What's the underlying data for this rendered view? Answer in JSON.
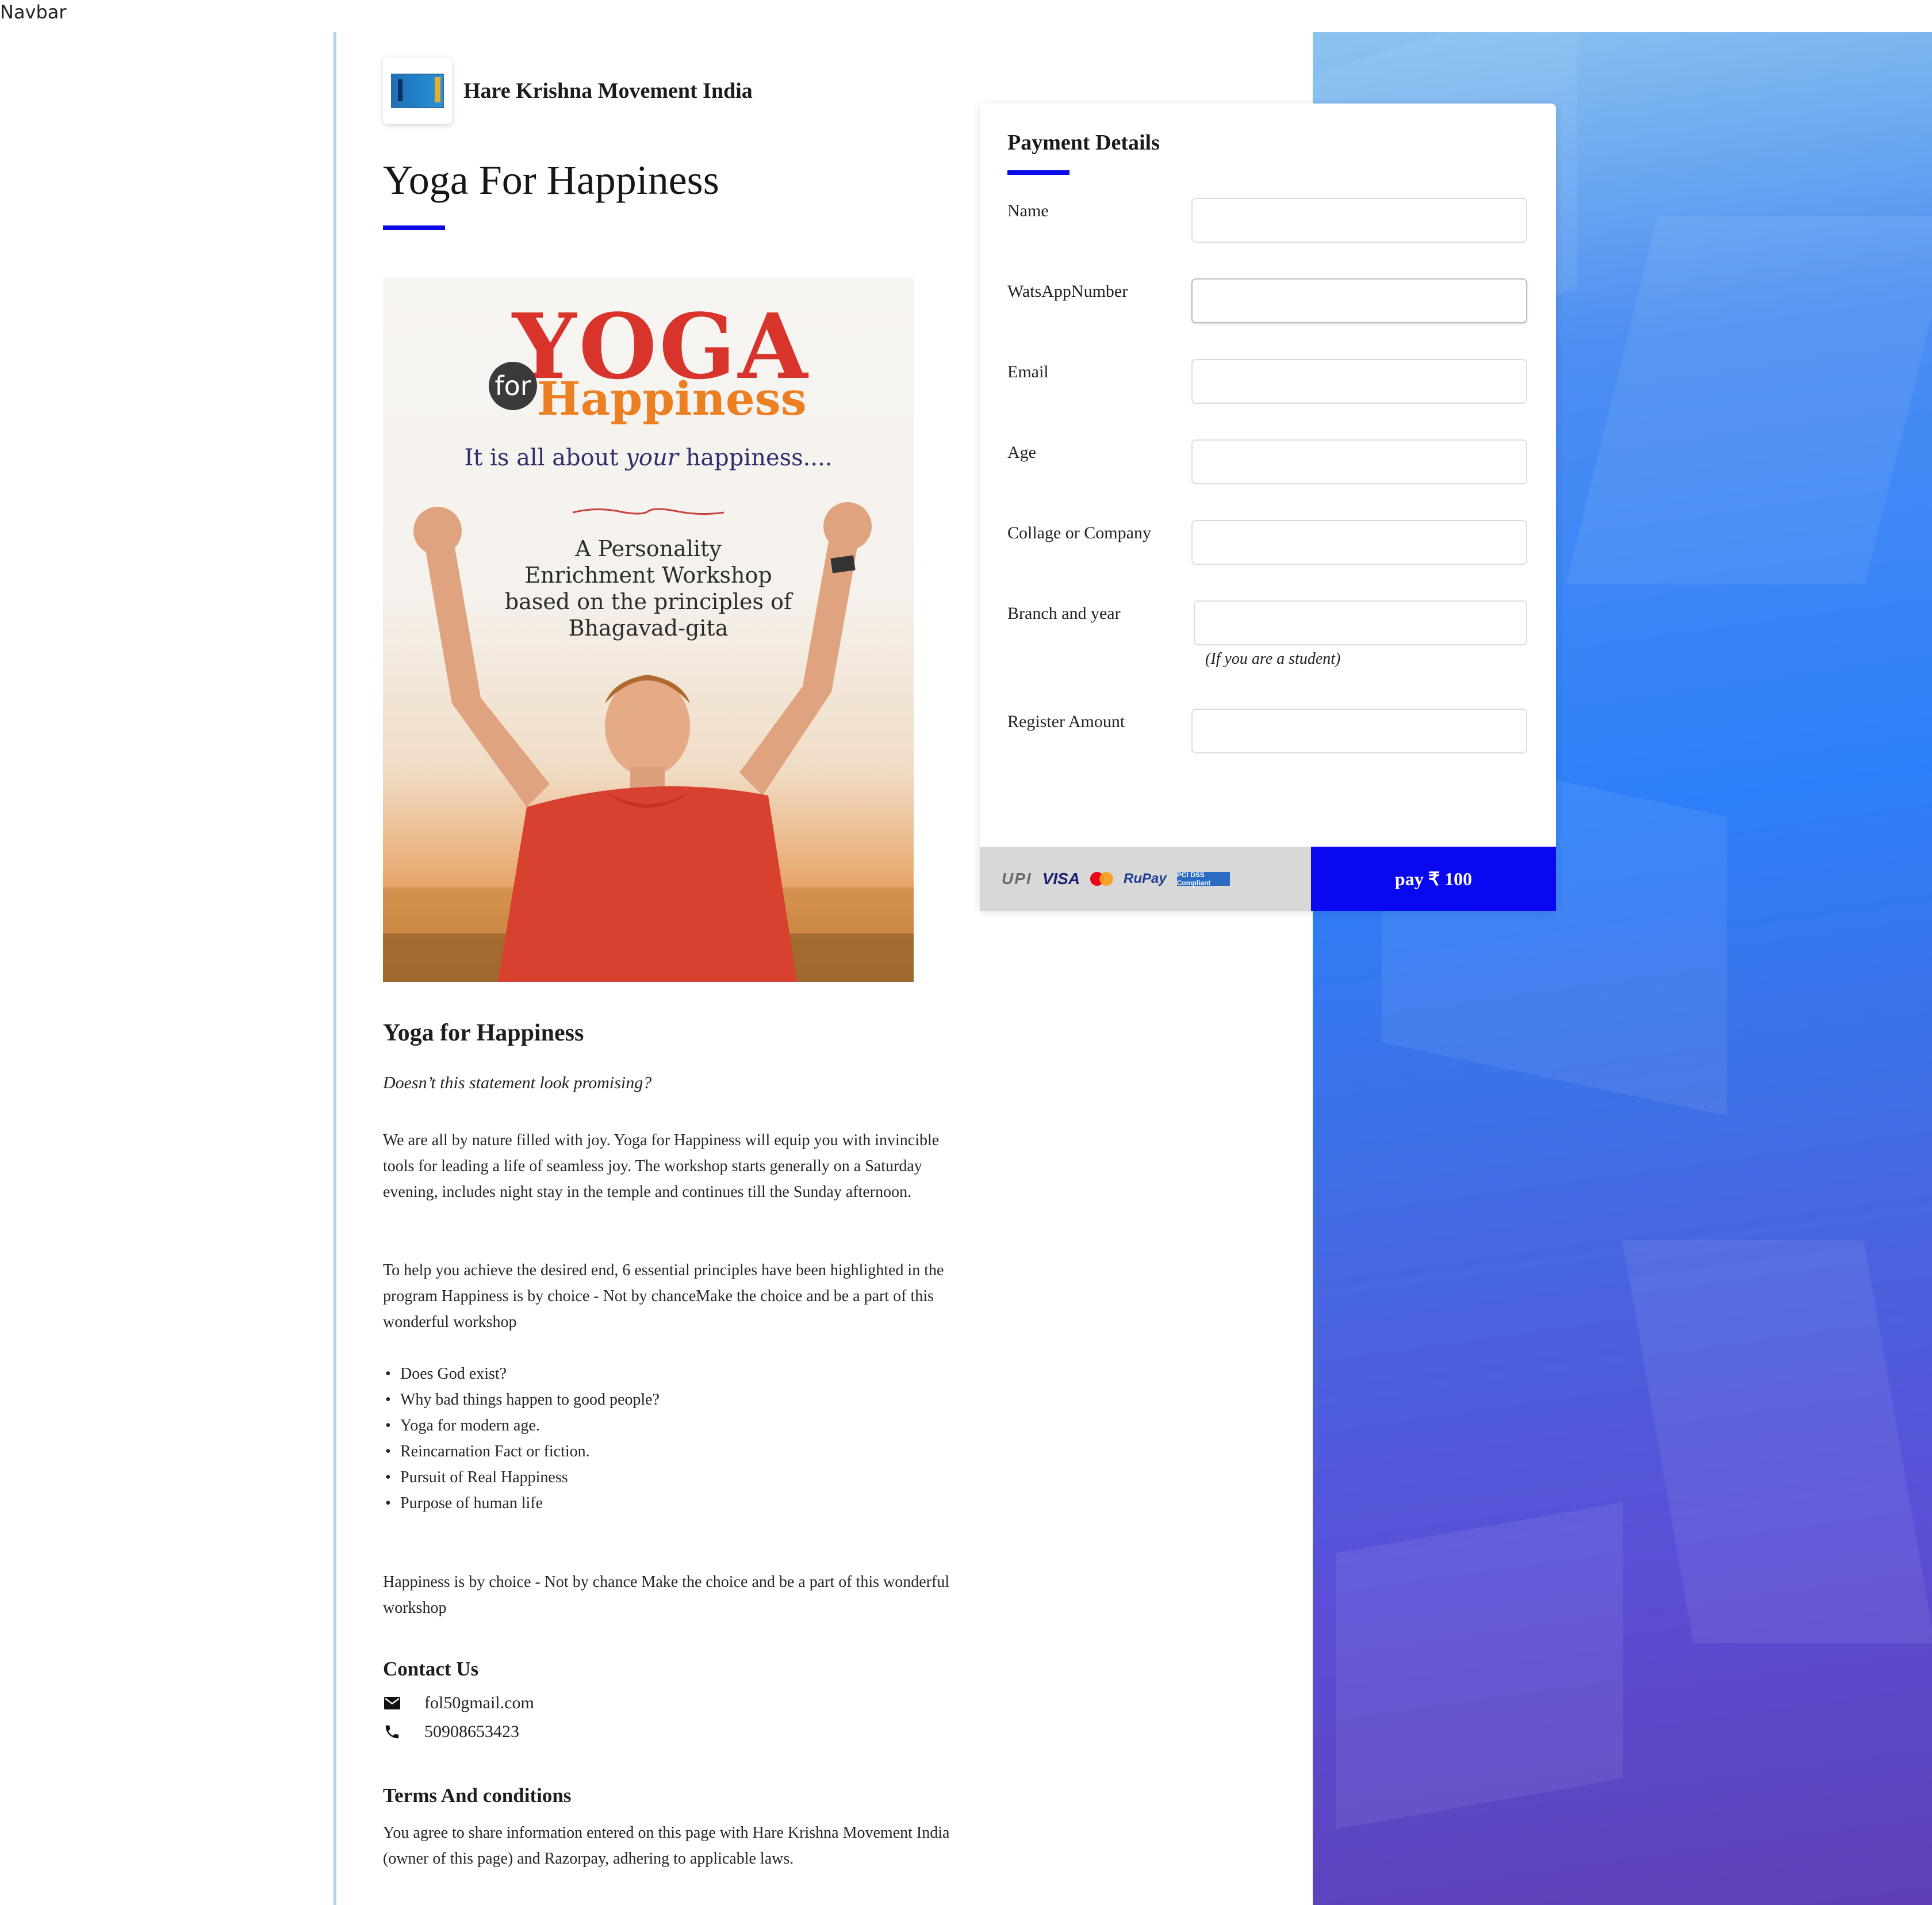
{
  "navbar": {
    "label": "Navbar"
  },
  "brand": {
    "name": "Hare Krishna Movement India",
    "logo_icon": "organization-logo-icon"
  },
  "page": {
    "title": "Yoga For Happiness"
  },
  "poster": {
    "headline_word": "YOGA",
    "for_word": "for",
    "happiness_word": "Happiness",
    "tagline_prefix": "It is all about ",
    "tagline_em": "your",
    "tagline_suffix": " happiness....",
    "subtitle_lines": [
      "A Personality",
      "Enrichment Workshop",
      "based on the principles of",
      "Bhagavad-gita"
    ]
  },
  "description": {
    "heading": "Yoga for Happiness",
    "tagline": "Doesn’t this statement look promising?",
    "paragraph_1": "We are all by nature filled with joy. Yoga for Happiness will equip you with invincible tools for leading a life of seamless joy. The workshop starts generally on a Saturday evening, includes night stay in the temple and continues till the Sunday afternoon.",
    "paragraph_2": "To help you achieve the desired end, 6 essential principles have been highlighted in the program Happiness is by choice - Not by chanceMake the choice and be a part of this wonderful workshop",
    "bullets": [
      "Does God exist?",
      "Why bad things happen to good people?",
      "Yoga for modern age.",
      "Reincarnation Fact or fiction.",
      "Pursuit of Real Happiness",
      "Purpose of human life"
    ],
    "paragraph_3": "Happiness is by choice - Not by chance Make the choice and be a part of this wonderful workshop"
  },
  "contact": {
    "heading": "Contact Us",
    "email": "fol50gmail.com",
    "phone": "50908653423",
    "email_icon": "mail-icon",
    "phone_icon": "phone-icon"
  },
  "terms": {
    "heading": "Terms And conditions",
    "text": "You agree to share information entered on this page with Hare Krishna Movement India (owner of this page) and Razorpay, adhering to applicable laws."
  },
  "payment": {
    "heading": "Payment Details",
    "fields": [
      {
        "label": "Name",
        "value": ""
      },
      {
        "label": "WatsAppNumber",
        "value": ""
      },
      {
        "label": "Email",
        "value": ""
      },
      {
        "label": "Age",
        "value": ""
      },
      {
        "label": "Collage or Company",
        "value": ""
      },
      {
        "label": "Branch and year",
        "value": ""
      },
      {
        "label": "Register Amount",
        "value": ""
      }
    ],
    "branch_hint": "(If you are a student)",
    "methods": {
      "upi": "UPI",
      "visa": "VISA",
      "rupay": "RuPay",
      "pci": "PCI DSS Compliant"
    },
    "button_label": "pay ₹ 100"
  },
  "colors": {
    "accent_blue": "#0a0ae6",
    "pay_button": "#0a08f0",
    "left_rule": "#a9d3ef",
    "methods_bar": "#d8d8d8"
  }
}
